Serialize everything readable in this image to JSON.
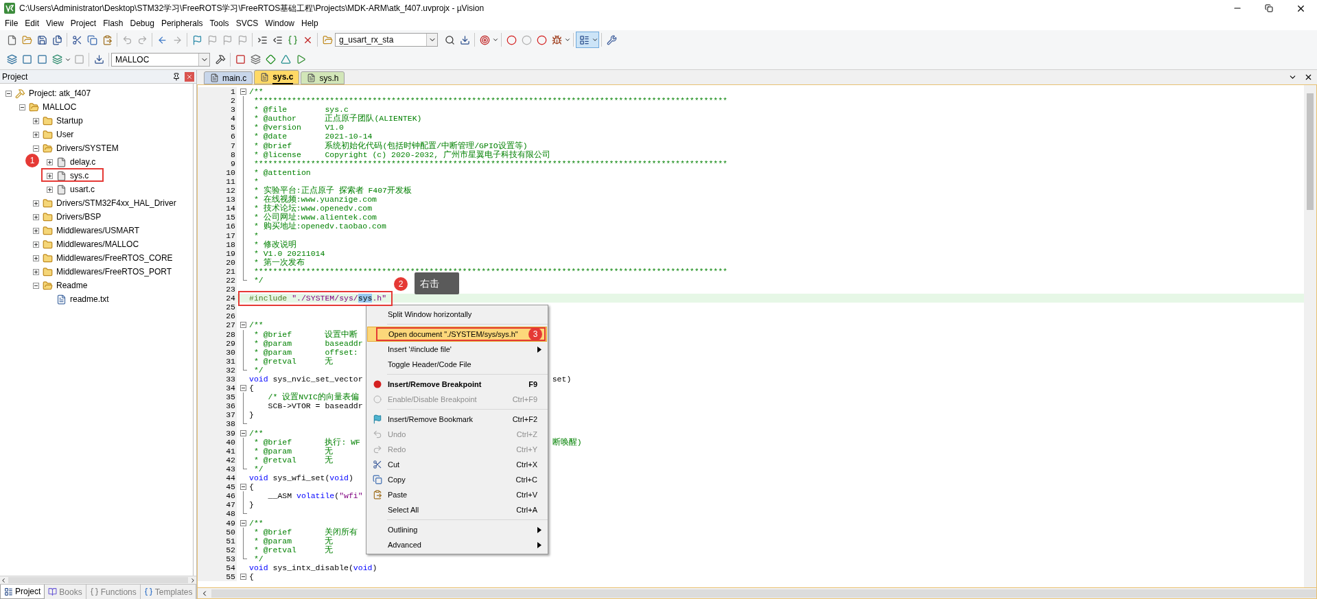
{
  "window": {
    "title": "C:\\Users\\Administrator\\Desktop\\STM32学习\\FreeROTS学习\\FreeRTOS基础工程\\Projects\\MDK-ARM\\atk_f407.uvprojx - µVision"
  },
  "menu_bar": [
    "File",
    "Edit",
    "View",
    "Project",
    "Flash",
    "Debug",
    "Peripherals",
    "Tools",
    "SVCS",
    "Window",
    "Help"
  ],
  "toolbar": {
    "symbol_combo": "g_usart_rx_sta",
    "target_combo": "MALLOC"
  },
  "project_panel": {
    "title": "Project",
    "tree": [
      {
        "label": "Project: atk_f407",
        "kind": "project",
        "expanded": true,
        "children": [
          {
            "label": "MALLOC",
            "kind": "target",
            "expanded": true,
            "children": [
              {
                "label": "Startup",
                "kind": "folder",
                "expanded": false
              },
              {
                "label": "User",
                "kind": "folder",
                "expanded": false
              },
              {
                "label": "Drivers/SYSTEM",
                "kind": "folder",
                "expanded": true,
                "children": [
                  {
                    "label": "delay.c",
                    "kind": "file",
                    "expanded": false
                  },
                  {
                    "label": "sys.c",
                    "kind": "file",
                    "expanded": false
                  },
                  {
                    "label": "usart.c",
                    "kind": "file",
                    "expanded": false
                  }
                ]
              },
              {
                "label": "Drivers/STM32F4xx_HAL_Driver",
                "kind": "folder",
                "expanded": false
              },
              {
                "label": "Drivers/BSP",
                "kind": "folder",
                "expanded": false
              },
              {
                "label": "Middlewares/USMART",
                "kind": "folder",
                "expanded": false
              },
              {
                "label": "Middlewares/MALLOC",
                "kind": "folder",
                "expanded": false
              },
              {
                "label": "Middlewares/FreeRTOS_CORE",
                "kind": "folder",
                "expanded": false
              },
              {
                "label": "Middlewares/FreeRTOS_PORT",
                "kind": "folder",
                "expanded": false
              },
              {
                "label": "Readme",
                "kind": "folder",
                "expanded": true,
                "children": [
                  {
                    "label": "readme.txt",
                    "kind": "text"
                  }
                ]
              }
            ]
          }
        ]
      }
    ],
    "bottom_tabs": [
      {
        "label": "Project",
        "selected": true
      },
      {
        "label": "Books",
        "selected": false
      },
      {
        "label": "Functions",
        "selected": false
      },
      {
        "label": "Templates",
        "selected": false
      }
    ]
  },
  "editor_tabs": [
    {
      "label": "main.c",
      "selected": false,
      "color": "#c8d6ea"
    },
    {
      "label": "sys.c",
      "selected": true,
      "color": "#ffd966"
    },
    {
      "label": "sys.h",
      "selected": false,
      "color": "#d2e6b8"
    }
  ],
  "code_lines": [
    {
      "n": "1",
      "fold": {
        "kind": "open"
      },
      "current": false,
      "segments": [
        {
          "kind": "comment",
          "text": "/**"
        }
      ]
    },
    {
      "n": "2",
      "fold": {
        "kind": "bar"
      },
      "current": false,
      "segments": [
        {
          "kind": "comment",
          "text": " ****************************************************************************************************"
        }
      ]
    },
    {
      "n": "3",
      "fold": {
        "kind": "bar"
      },
      "current": false,
      "segments": [
        {
          "kind": "comment",
          "text": " * @file        sys.c"
        }
      ]
    },
    {
      "n": "4",
      "fold": {
        "kind": "bar"
      },
      "current": false,
      "segments": [
        {
          "kind": "comment",
          "text": " * @author      正点原子团队(ALIENTEK)"
        }
      ]
    },
    {
      "n": "5",
      "fold": {
        "kind": "bar"
      },
      "current": false,
      "segments": [
        {
          "kind": "comment",
          "text": " * @version     V1.0"
        }
      ]
    },
    {
      "n": "6",
      "fold": {
        "kind": "bar"
      },
      "current": false,
      "segments": [
        {
          "kind": "comment",
          "text": " * @date        2021-10-14"
        }
      ]
    },
    {
      "n": "7",
      "fold": {
        "kind": "bar"
      },
      "current": false,
      "segments": [
        {
          "kind": "comment",
          "text": " * @brief       系统初始化代码(包括时钟配置/中断管理/GPIO设置等)"
        }
      ]
    },
    {
      "n": "8",
      "fold": {
        "kind": "bar"
      },
      "current": false,
      "segments": [
        {
          "kind": "comment",
          "text": " * @license     Copyright (c) 2020-2032, 广州市星翼电子科技有限公司"
        }
      ]
    },
    {
      "n": "9",
      "fold": {
        "kind": "bar"
      },
      "current": false,
      "segments": [
        {
          "kind": "comment",
          "text": " ****************************************************************************************************"
        }
      ]
    },
    {
      "n": "10",
      "fold": {
        "kind": "bar"
      },
      "current": false,
      "segments": [
        {
          "kind": "comment",
          "text": " * @attention"
        }
      ]
    },
    {
      "n": "11",
      "fold": {
        "kind": "bar"
      },
      "current": false,
      "segments": [
        {
          "kind": "comment",
          "text": " *"
        }
      ]
    },
    {
      "n": "12",
      "fold": {
        "kind": "bar"
      },
      "current": false,
      "segments": [
        {
          "kind": "comment",
          "text": " * 实验平台:正点原子 探索者 F407开发板"
        }
      ]
    },
    {
      "n": "13",
      "fold": {
        "kind": "bar"
      },
      "current": false,
      "segments": [
        {
          "kind": "comment",
          "text": " * 在线视频:www.yuanzige.com"
        }
      ]
    },
    {
      "n": "14",
      "fold": {
        "kind": "bar"
      },
      "current": false,
      "segments": [
        {
          "kind": "comment",
          "text": " * 技术论坛:www.openedv.com"
        }
      ]
    },
    {
      "n": "15",
      "fold": {
        "kind": "bar"
      },
      "current": false,
      "segments": [
        {
          "kind": "comment",
          "text": " * 公司网址:www.alientek.com"
        }
      ]
    },
    {
      "n": "16",
      "fold": {
        "kind": "bar"
      },
      "current": false,
      "segments": [
        {
          "kind": "comment",
          "text": " * 购买地址:openedv.taobao.com"
        }
      ]
    },
    {
      "n": "17",
      "fold": {
        "kind": "bar"
      },
      "current": false,
      "segments": [
        {
          "kind": "comment",
          "text": " *"
        }
      ]
    },
    {
      "n": "18",
      "fold": {
        "kind": "bar"
      },
      "current": false,
      "segments": [
        {
          "kind": "comment",
          "text": " * 修改说明"
        }
      ]
    },
    {
      "n": "19",
      "fold": {
        "kind": "bar"
      },
      "current": false,
      "segments": [
        {
          "kind": "comment",
          "text": " * V1.0 20211014"
        }
      ]
    },
    {
      "n": "20",
      "fold": {
        "kind": "bar"
      },
      "current": false,
      "segments": [
        {
          "kind": "comment",
          "text": " * 第一次发布"
        }
      ]
    },
    {
      "n": "21",
      "fold": {
        "kind": "bar"
      },
      "current": false,
      "segments": [
        {
          "kind": "comment",
          "text": " ****************************************************************************************************"
        }
      ]
    },
    {
      "n": "22",
      "fold": {
        "kind": "end"
      },
      "current": false,
      "segments": [
        {
          "kind": "comment",
          "text": " */"
        }
      ]
    },
    {
      "n": "23",
      "current": false
    },
    {
      "n": "24",
      "current": true,
      "segments": [
        {
          "kind": "directive",
          "text": "#include "
        },
        {
          "kind": "string",
          "text": "\"./SYSTEM/sys/"
        },
        {
          "kind": "selection",
          "text": "sys"
        },
        {
          "kind": "string",
          "text": ".h\""
        }
      ]
    },
    {
      "n": "25",
      "current": false
    },
    {
      "n": "26",
      "current": false
    },
    {
      "n": "27",
      "fold": {
        "kind": "open"
      },
      "current": false,
      "segments": [
        {
          "kind": "comment",
          "text": "/**"
        }
      ]
    },
    {
      "n": "28",
      "fold": {
        "kind": "bar"
      },
      "current": false,
      "segments": [
        {
          "kind": "comment",
          "text": " * @brief       设置中断"
        }
      ]
    },
    {
      "n": "29",
      "fold": {
        "kind": "bar"
      },
      "current": false,
      "segments": [
        {
          "kind": "comment",
          "text": " * @param       baseaddr"
        }
      ]
    },
    {
      "n": "30",
      "fold": {
        "kind": "bar"
      },
      "current": false,
      "segments": [
        {
          "kind": "comment",
          "text": " * @param       offset:"
        }
      ]
    },
    {
      "n": "31",
      "fold": {
        "kind": "bar"
      },
      "current": false,
      "segments": [
        {
          "kind": "comment",
          "text": " * @retval      无"
        }
      ]
    },
    {
      "n": "32",
      "fold": {
        "kind": "end"
      },
      "current": false,
      "segments": [
        {
          "kind": "comment",
          "text": " */"
        }
      ]
    },
    {
      "n": "33",
      "current": false,
      "segments": [
        {
          "kind": "keyword",
          "text": "void"
        },
        {
          "kind": "plain",
          "text": " sys_nvic_set_vector"
        }
      ],
      "right": [
        {
          "kind": "plain",
          "text": "set)"
        }
      ]
    },
    {
      "n": "34",
      "fold": {
        "kind": "open"
      },
      "current": false,
      "segments": [
        {
          "kind": "plain",
          "text": "{"
        }
      ]
    },
    {
      "n": "35",
      "fold": {
        "kind": "bar"
      },
      "current": false,
      "segments": [
        {
          "kind": "comment",
          "text": "    /* 设置NVIC的向量表偏"
        }
      ]
    },
    {
      "n": "36",
      "fold": {
        "kind": "bar"
      },
      "current": false,
      "segments": [
        {
          "kind": "plain",
          "text": "    SCB->VTOR = baseaddr"
        }
      ]
    },
    {
      "n": "37",
      "fold": {
        "kind": "bar"
      },
      "current": false,
      "segments": [
        {
          "kind": "plain",
          "text": "}"
        }
      ]
    },
    {
      "n": "38",
      "fold": {
        "kind": "end"
      },
      "current": false
    },
    {
      "n": "39",
      "fold": {
        "kind": "open"
      },
      "current": false,
      "segments": [
        {
          "kind": "comment",
          "text": "/**"
        }
      ]
    },
    {
      "n": "40",
      "fold": {
        "kind": "bar"
      },
      "current": false,
      "segments": [
        {
          "kind": "comment",
          "text": " * @brief       执行: WF"
        }
      ],
      "right": [
        {
          "kind": "comment",
          "text": "断唤醒)"
        }
      ]
    },
    {
      "n": "41",
      "fold": {
        "kind": "bar"
      },
      "current": false,
      "segments": [
        {
          "kind": "comment",
          "text": " * @param       无"
        }
      ]
    },
    {
      "n": "42",
      "fold": {
        "kind": "bar"
      },
      "current": false,
      "segments": [
        {
          "kind": "comment",
          "text": " * @retval      无"
        }
      ]
    },
    {
      "n": "43",
      "fold": {
        "kind": "end"
      },
      "current": false,
      "segments": [
        {
          "kind": "comment",
          "text": " */"
        }
      ]
    },
    {
      "n": "44",
      "current": false,
      "segments": [
        {
          "kind": "keyword",
          "text": "void"
        },
        {
          "kind": "plain",
          "text": " sys_wfi_set("
        },
        {
          "kind": "keyword",
          "text": "void"
        },
        {
          "kind": "plain",
          "text": ")"
        }
      ]
    },
    {
      "n": "45",
      "fold": {
        "kind": "open"
      },
      "current": false,
      "segments": [
        {
          "kind": "plain",
          "text": "{"
        }
      ]
    },
    {
      "n": "46",
      "fold": {
        "kind": "bar"
      },
      "current": false,
      "segments": [
        {
          "kind": "plain",
          "text": "    __ASM "
        },
        {
          "kind": "keyword",
          "text": "volatile"
        },
        {
          "kind": "plain",
          "text": "("
        },
        {
          "kind": "string",
          "text": "\"wfi\""
        }
      ]
    },
    {
      "n": "47",
      "fold": {
        "kind": "bar"
      },
      "current": false,
      "segments": [
        {
          "kind": "plain",
          "text": "}"
        }
      ]
    },
    {
      "n": "48",
      "fold": {
        "kind": "end"
      },
      "current": false
    },
    {
      "n": "49",
      "fold": {
        "kind": "open"
      },
      "current": false,
      "segments": [
        {
          "kind": "comment",
          "text": "/**"
        }
      ]
    },
    {
      "n": "50",
      "fold": {
        "kind": "bar"
      },
      "current": false,
      "segments": [
        {
          "kind": "comment",
          "text": " * @brief       关闭所有"
        }
      ]
    },
    {
      "n": "51",
      "fold": {
        "kind": "bar"
      },
      "current": false,
      "segments": [
        {
          "kind": "comment",
          "text": " * @param       无"
        }
      ]
    },
    {
      "n": "52",
      "fold": {
        "kind": "bar"
      },
      "current": false,
      "segments": [
        {
          "kind": "comment",
          "text": " * @retval      无"
        }
      ]
    },
    {
      "n": "53",
      "fold": {
        "kind": "end"
      },
      "current": false,
      "segments": [
        {
          "kind": "comment",
          "text": " */"
        }
      ]
    },
    {
      "n": "54",
      "current": false,
      "segments": [
        {
          "kind": "keyword",
          "text": "void"
        },
        {
          "kind": "plain",
          "text": " sys_intx_disable("
        },
        {
          "kind": "keyword",
          "text": "void"
        },
        {
          "kind": "plain",
          "text": ")"
        }
      ]
    },
    {
      "n": "55",
      "fold": {
        "kind": "open"
      },
      "current": false,
      "segments": [
        {
          "kind": "plain",
          "text": "{"
        }
      ]
    }
  ],
  "context_menu": [
    {
      "kind": "item",
      "label": "Split Window horizontally",
      "disabled": false,
      "selected": false,
      "submenu": false
    },
    {
      "kind": "separator"
    },
    {
      "kind": "item",
      "label": "Open document \"./SYSTEM/sys/sys.h\"",
      "disabled": false,
      "selected": true,
      "submenu": false
    },
    {
      "kind": "item",
      "label": "Insert '#include file'",
      "disabled": false,
      "selected": false,
      "submenu": true
    },
    {
      "kind": "item",
      "label": "Toggle Header/Code File",
      "disabled": false,
      "selected": false,
      "submenu": false
    },
    {
      "kind": "separator"
    },
    {
      "kind": "item",
      "label": "Insert/Remove Breakpoint",
      "shortcut": "F9",
      "bold": true,
      "disabled": false,
      "selected": false,
      "submenu": false
    },
    {
      "kind": "item",
      "label": "Enable/Disable Breakpoint",
      "shortcut": "Ctrl+F9",
      "disabled": true,
      "selected": false,
      "submenu": false
    },
    {
      "kind": "separator"
    },
    {
      "kind": "item",
      "label": "Insert/Remove Bookmark",
      "shortcut": "Ctrl+F2",
      "disabled": false,
      "selected": false,
      "submenu": false
    },
    {
      "kind": "item",
      "label": "Undo",
      "shortcut": "Ctrl+Z",
      "disabled": true,
      "selected": false,
      "submenu": false
    },
    {
      "kind": "item",
      "label": "Redo",
      "shortcut": "Ctrl+Y",
      "disabled": true,
      "selected": false,
      "submenu": false
    },
    {
      "kind": "item",
      "label": "Cut",
      "shortcut": "Ctrl+X",
      "disabled": false,
      "selected": false,
      "submenu": false
    },
    {
      "kind": "item",
      "label": "Copy",
      "shortcut": "Ctrl+C",
      "disabled": false,
      "selected": false,
      "submenu": false
    },
    {
      "kind": "item",
      "label": "Paste",
      "shortcut": "Ctrl+V",
      "disabled": false,
      "selected": false,
      "submenu": false
    },
    {
      "kind": "item",
      "label": "Select All",
      "shortcut": "Ctrl+A",
      "disabled": false,
      "selected": false,
      "submenu": false
    },
    {
      "kind": "separator"
    },
    {
      "kind": "item",
      "label": "Outlining",
      "disabled": false,
      "selected": false,
      "submenu": true
    },
    {
      "kind": "item",
      "label": "Advanced",
      "disabled": false,
      "selected": false,
      "submenu": true
    }
  ],
  "annotations": {
    "badges": [
      "1",
      "2",
      "3"
    ],
    "callout": "右击"
  }
}
